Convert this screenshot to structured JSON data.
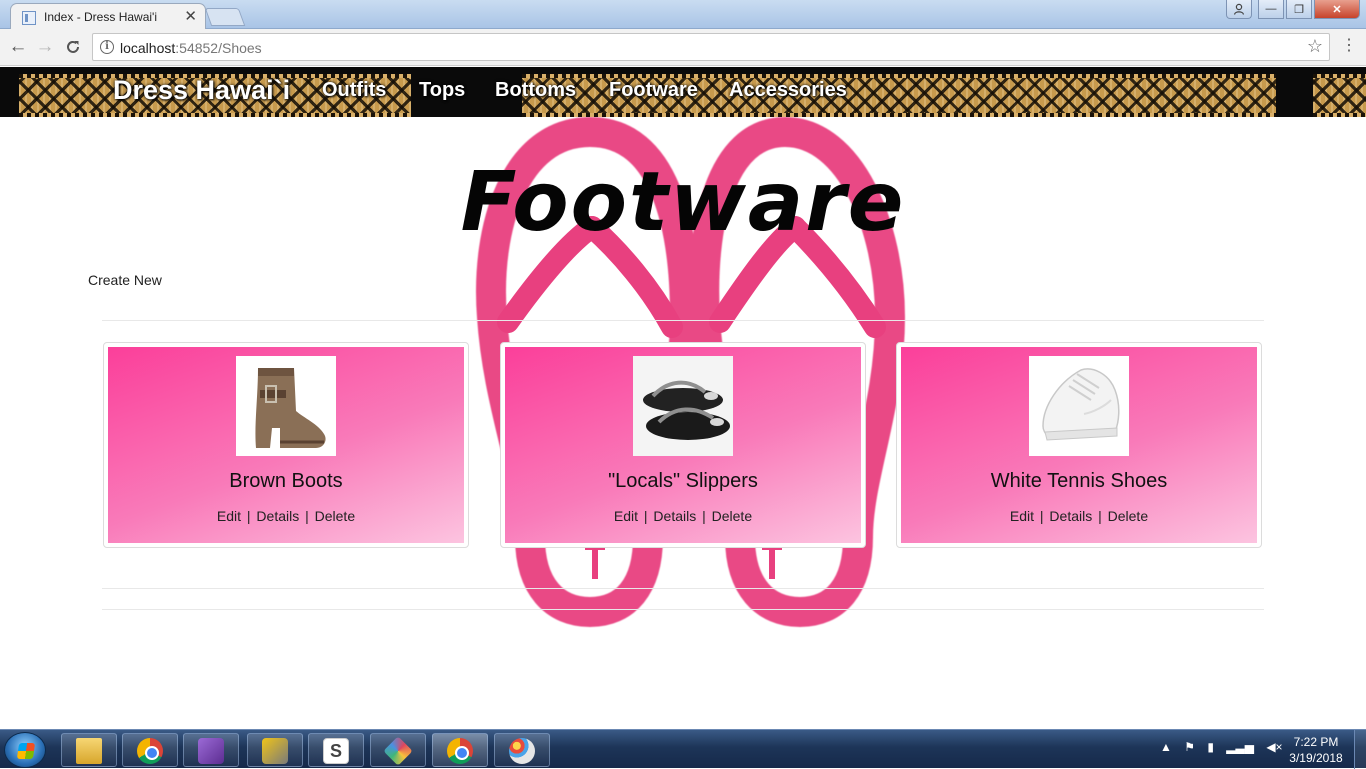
{
  "browser": {
    "tab_title": "Index - Dress Hawai'i",
    "tab_close": "✕",
    "url_host": "localhost",
    "url_path": ":54852/Shoes",
    "window_buttons": {
      "minimize": "—",
      "maximize": "❐",
      "close": "✕"
    }
  },
  "site": {
    "brand": "Dress Hawai`i",
    "nav": [
      "Outfits",
      "Tops",
      "Bottoms",
      "Footware",
      "Accessories"
    ]
  },
  "page": {
    "title": "Footware",
    "create_new": "Create New"
  },
  "products": [
    {
      "name": "Brown Boots",
      "image": "brown-ankle-boot"
    },
    {
      "name": "\"Locals\" Slippers",
      "image": "black-flip-flops"
    },
    {
      "name": "White Tennis Shoes",
      "image": "white-sneaker"
    }
  ],
  "actions": {
    "edit": "Edit",
    "details": "Details",
    "delete": "Delete",
    "separator": "|"
  },
  "taskbar": {
    "items": [
      "file-explorer",
      "chrome",
      "visual-studio",
      "tools",
      "slack",
      "git-client",
      "chrome",
      "paint"
    ],
    "active_index": 6,
    "time": "7:22 PM",
    "date": "3/19/2018"
  },
  "colors": {
    "card_gradient_start": "#fb3f9a",
    "card_gradient_end": "#fcc4e0",
    "flipflop_pink": "#e8407f"
  }
}
